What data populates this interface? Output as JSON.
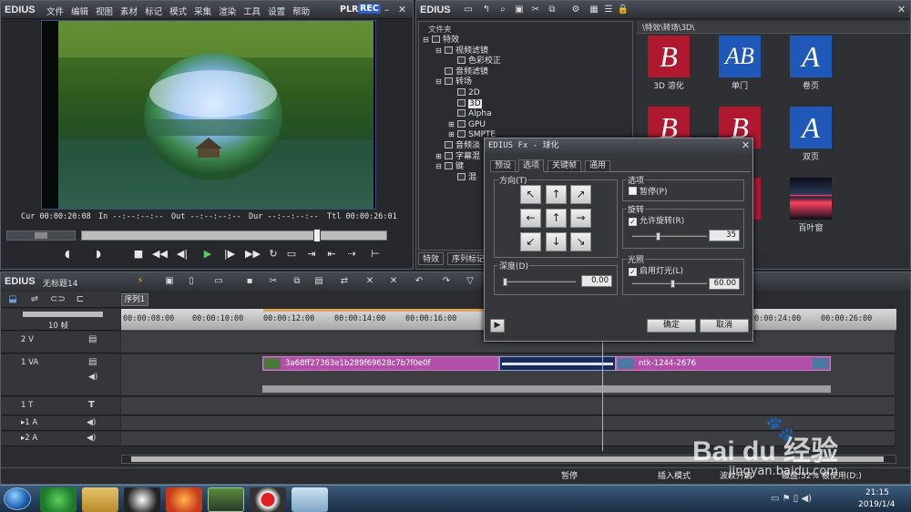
{
  "player": {
    "brand": "EDIUS",
    "menu": [
      "文件",
      "编辑",
      "视图",
      "素材",
      "标记",
      "模式",
      "采集",
      "渲染",
      "工具",
      "设置",
      "帮助"
    ],
    "plr": "PLR",
    "rec": "REC",
    "cur": "Cur 00:00:20:08",
    "in": "In --:--:--:--",
    "out": "Out --:--:--:--",
    "dur": "Dur --:--:--:--",
    "ttl": "Ttl 00:00:26:01"
  },
  "bin": {
    "brand": "EDIUS",
    "tree_header": "文件夹",
    "tree": [
      {
        "label": "特效",
        "indent": 0,
        "expander": "⊟"
      },
      {
        "label": "视频滤镜",
        "indent": 1,
        "expander": "⊟"
      },
      {
        "label": "色彩校正",
        "indent": 2,
        "expander": ""
      },
      {
        "label": "音频滤镜",
        "indent": 1,
        "expander": ""
      },
      {
        "label": "转场",
        "indent": 1,
        "expander": "⊟"
      },
      {
        "label": "2D",
        "indent": 2,
        "expander": ""
      },
      {
        "label": "3D",
        "indent": 2,
        "expander": ""
      },
      {
        "label": "Alpha",
        "indent": 2,
        "expander": ""
      },
      {
        "label": "GPU",
        "indent": 2,
        "expander": "⊞"
      },
      {
        "label": "SMPTE",
        "indent": 2,
        "expander": "⊞"
      },
      {
        "label": "音频淡",
        "indent": 1,
        "expander": ""
      },
      {
        "label": "字幕混",
        "indent": 1,
        "expander": "⊞"
      },
      {
        "label": "键",
        "indent": 1,
        "expander": "⊟"
      },
      {
        "label": "混",
        "indent": 2,
        "expander": ""
      }
    ],
    "path": "\\特效\\转场\\3D\\",
    "thumbs": [
      {
        "glyph": "B",
        "label": "3D 溶化",
        "bg": "#b01830"
      },
      {
        "glyph": "AB",
        "label": "单门",
        "bg": "#1f58b8"
      },
      {
        "glyph": "A",
        "label": "卷页",
        "bg": "#1f58b8"
      },
      {
        "glyph": "B",
        "label": "",
        "bg": "#b01830"
      },
      {
        "glyph": "B",
        "label": "",
        "bg": "#b01830"
      },
      {
        "glyph": "A",
        "label": "双页",
        "bg": "#1f58b8"
      },
      {
        "glyph": "",
        "label": "",
        "bg": "#3a3c40"
      },
      {
        "glyph": "",
        "label": "",
        "bg": "#b01830"
      },
      {
        "glyph": "",
        "label": "百叶窗",
        "bg": "#1a2436"
      }
    ],
    "tabs": [
      "特效",
      "序列标记"
    ]
  },
  "timeline": {
    "brand": "EDIUS",
    "project_name": "无标题14",
    "sequence_tab": "序列1",
    "zoom": "10 帧",
    "ruler": [
      "00:00:08:00",
      "00:00:10:00",
      "00:00:12:00",
      "00:00:14:00",
      "00:00:16:00",
      "00:00:24:00",
      "00:00:26:00"
    ],
    "tracks": [
      {
        "name": "2 V"
      },
      {
        "name": "1 VA"
      },
      {
        "name": "1 T"
      },
      {
        "name": "▸1 A"
      },
      {
        "name": "▸2 A"
      }
    ],
    "clip1": "3a68ff27363e1b289f69628c7b7f0e0f",
    "clip2": "ntk-1244-2676"
  },
  "dialog": {
    "title": "EDIUS Fx - 球化",
    "tabs": [
      "预设",
      "选项",
      "关键帧",
      "通用"
    ],
    "direction_label": "方向(T)",
    "arrows": [
      "↖",
      "↑",
      "↗",
      "←",
      "↑",
      "→",
      "↙",
      "↓",
      "↘"
    ],
    "depth_label": "深度(D)",
    "depth_value": "0.00",
    "options_label": "选项",
    "pause_label": "暂停(P)",
    "rotation_group": "旋转",
    "allow_rotation": "允许旋转(R)",
    "rotation_value": "35",
    "lighting_group": "光照",
    "enable_light": "启用灯光(L)",
    "light_value": "60.00",
    "ok": "确定",
    "cancel": "取消"
  },
  "statusbar": {
    "pause": "暂停",
    "insert_mode": "插入模式",
    "ripple": "波纹开启",
    "disk": "磁盘:52% 被使用(D:)"
  },
  "taskbar": {
    "time": "21:15",
    "date": "2019/1/4"
  },
  "watermark": {
    "brand": "Bai du 经验",
    "url": "jingyan.baidu.com"
  }
}
